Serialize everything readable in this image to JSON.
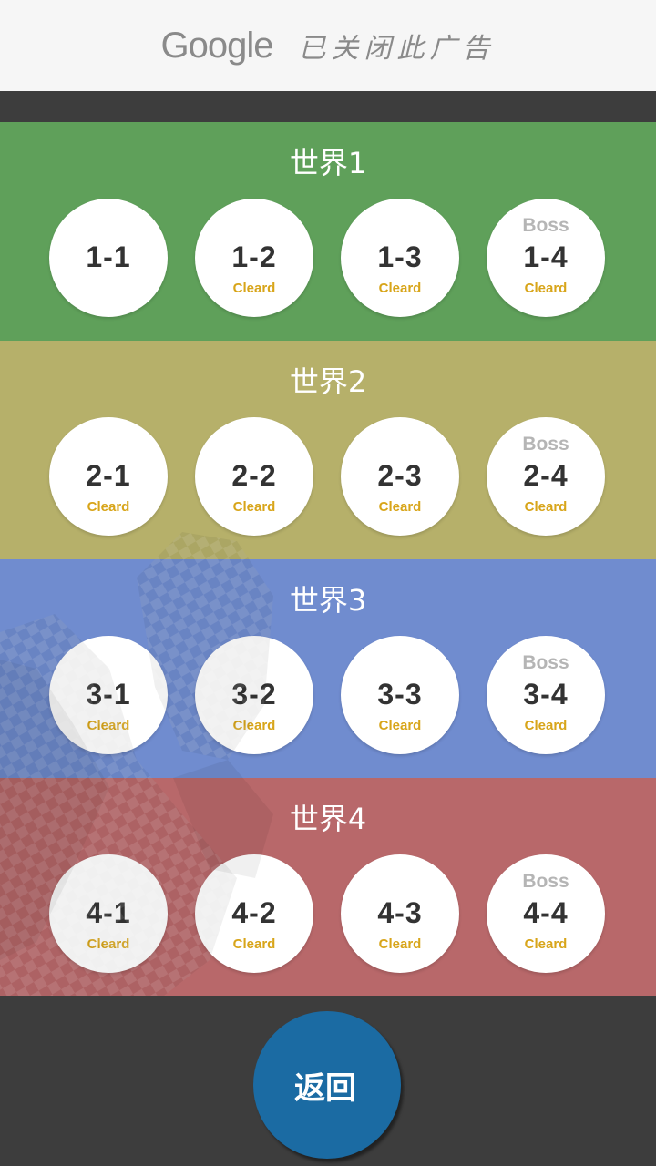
{
  "ad": {
    "brand": "Google",
    "message": "已关闭此广告"
  },
  "worlds": [
    {
      "title": "世界1",
      "color": "#5fa05a",
      "levels": [
        {
          "label": "1-1",
          "status": "",
          "boss": ""
        },
        {
          "label": "1-2",
          "status": "Cleard",
          "boss": ""
        },
        {
          "label": "1-3",
          "status": "Cleard",
          "boss": ""
        },
        {
          "label": "1-4",
          "status": "Cleard",
          "boss": "Boss"
        }
      ]
    },
    {
      "title": "世界2",
      "color": "#b6b06a",
      "levels": [
        {
          "label": "2-1",
          "status": "Cleard",
          "boss": ""
        },
        {
          "label": "2-2",
          "status": "Cleard",
          "boss": ""
        },
        {
          "label": "2-3",
          "status": "Cleard",
          "boss": ""
        },
        {
          "label": "2-4",
          "status": "Cleard",
          "boss": "Boss"
        }
      ]
    },
    {
      "title": "世界3",
      "color": "#708ccf",
      "levels": [
        {
          "label": "3-1",
          "status": "Cleard",
          "boss": ""
        },
        {
          "label": "3-2",
          "status": "Cleard",
          "boss": ""
        },
        {
          "label": "3-3",
          "status": "Cleard",
          "boss": ""
        },
        {
          "label": "3-4",
          "status": "Cleard",
          "boss": "Boss"
        }
      ]
    },
    {
      "title": "世界4",
      "color": "#b8686a",
      "levels": [
        {
          "label": "4-1",
          "status": "Cleard",
          "boss": ""
        },
        {
          "label": "4-2",
          "status": "Cleard",
          "boss": ""
        },
        {
          "label": "4-3",
          "status": "Cleard",
          "boss": ""
        },
        {
          "label": "4-4",
          "status": "Cleard",
          "boss": "Boss"
        }
      ]
    }
  ],
  "back_button": {
    "label": "返回",
    "color": "#1b6ba3"
  }
}
